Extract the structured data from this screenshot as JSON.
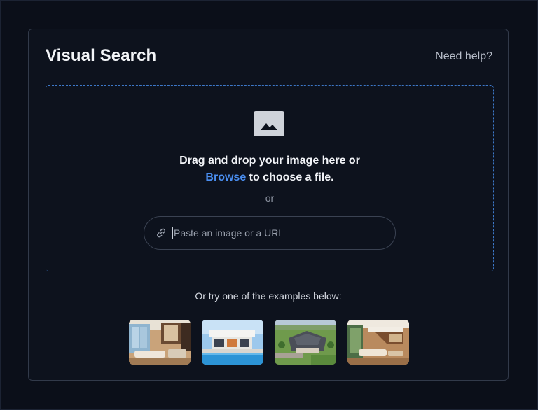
{
  "header": {
    "title": "Visual Search",
    "help_label": "Need help?"
  },
  "dropzone": {
    "icon": "image-icon",
    "line1": "Drag and drop your image here or",
    "browse_label": "Browse",
    "line2_suffix": " to choose a file.",
    "or_label": "or"
  },
  "url_input": {
    "icon": "link-icon",
    "placeholder": "Paste an image or a URL",
    "value": ""
  },
  "examples": {
    "label": "Or try one of the examples below:",
    "items": [
      {
        "name": "example-image-1"
      },
      {
        "name": "example-image-2"
      },
      {
        "name": "example-image-3"
      },
      {
        "name": "example-image-4"
      }
    ]
  },
  "colors": {
    "background": "#0b0f19",
    "accent": "#4a8ef0",
    "dropzone_border": "#3d78c9",
    "card_border": "#323a4a"
  }
}
